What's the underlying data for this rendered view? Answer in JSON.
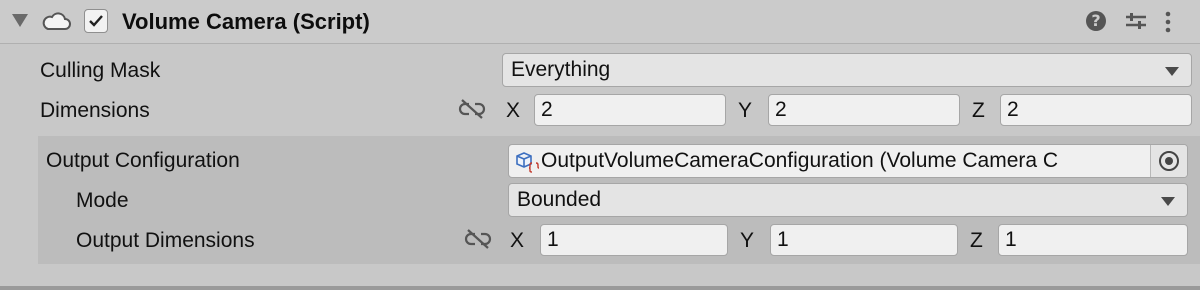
{
  "component": {
    "title": "Volume Camera (Script)",
    "enabled": true
  },
  "fields": {
    "culling_mask": {
      "label": "Culling Mask",
      "value": "Everything"
    },
    "dimensions": {
      "label": "Dimensions",
      "x_label": "X",
      "x": "2",
      "y_label": "Y",
      "y": "2",
      "z_label": "Z",
      "z": "2"
    },
    "output_configuration": {
      "label": "Output Configuration",
      "value": "OutputVolumeCameraConfiguration (Volume Camera C"
    },
    "mode": {
      "label": "Mode",
      "value": "Bounded"
    },
    "output_dimensions": {
      "label": "Output Dimensions",
      "x_label": "X",
      "x": "1",
      "y_label": "Y",
      "y": "1",
      "z_label": "Z",
      "z": "1"
    }
  },
  "icons": {
    "foldout": "triangle-down-icon",
    "script": "cloud-script-icon",
    "help": "help-icon",
    "presets": "sliders-icon",
    "menu": "kebab-menu-icon",
    "constrain": "broken-link-icon",
    "object": "cube-script-icon",
    "picker": "object-picker-icon"
  }
}
